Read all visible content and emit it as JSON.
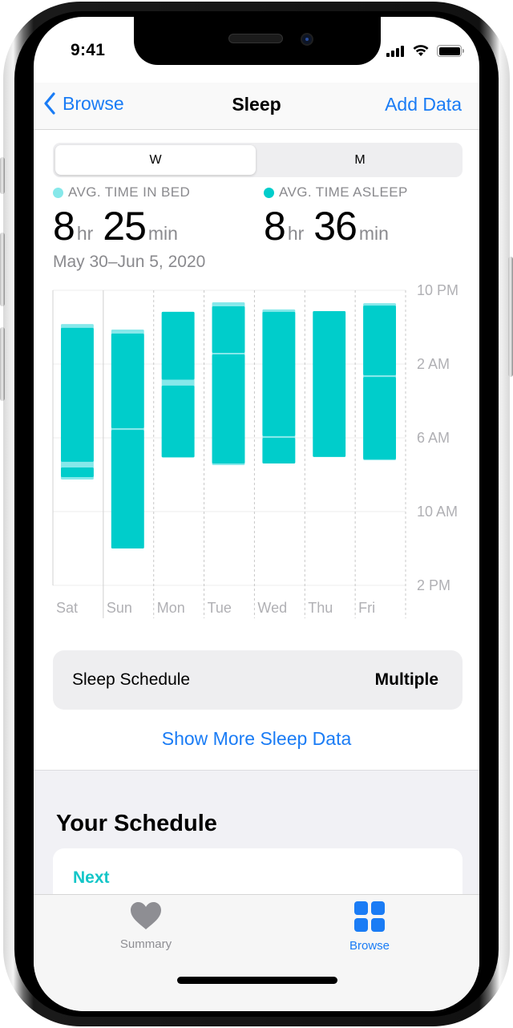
{
  "status_bar": {
    "time": "9:41",
    "signal_icon": "cellular-signal-icon",
    "wifi_icon": "wifi-icon",
    "battery_icon": "battery-icon"
  },
  "nav": {
    "back_label": "Browse",
    "title": "Sleep",
    "action_label": "Add Data"
  },
  "segmented": {
    "options": [
      "W",
      "M"
    ],
    "selected": "W"
  },
  "stats": {
    "in_bed": {
      "label": "AVG. TIME IN BED",
      "hours": "8",
      "hr_unit": "hr",
      "minutes": "25",
      "min_unit": "min",
      "color": "#86e8ea"
    },
    "asleep": {
      "label": "AVG. TIME ASLEEP",
      "hours": "8",
      "hr_unit": "hr",
      "minutes": "36",
      "min_unit": "min",
      "color": "#00cdcb"
    }
  },
  "date_range": "May 30–Jun 5, 2020",
  "chart_data": {
    "type": "bar",
    "subtype": "floating-range",
    "title": "",
    "xlabel": "",
    "ylabel": "",
    "units": "hours after 10 PM",
    "categories": [
      "Sat",
      "Sun",
      "Mon",
      "Tue",
      "Wed",
      "Thu",
      "Fri"
    ],
    "y_ticks": [
      "10 PM",
      "2 AM",
      "6 AM",
      "10 AM",
      "2 PM"
    ],
    "y_tick_values": [
      0,
      4,
      8,
      12,
      16
    ],
    "ylim": [
      0,
      16
    ],
    "grid": true,
    "series": [
      {
        "name": "In Bed",
        "color": "#86e8ea",
        "values": [
          [
            [
              1.83,
              10.26
            ]
          ],
          [
            [
              2.13,
              14.0
            ]
          ],
          [
            [
              1.17,
              9.06
            ]
          ],
          [
            [
              0.65,
              9.48
            ]
          ],
          [
            [
              1.04,
              9.39
            ]
          ],
          [],
          [
            [
              0.7,
              9.22
            ]
          ]
        ]
      },
      {
        "name": "Asleep",
        "color": "#00cdcb",
        "values": [
          [
            [
              2.04,
              9.3
            ],
            [
              9.61,
              10.13
            ]
          ],
          [
            [
              2.35,
              7.48
            ],
            [
              7.57,
              14.0
            ]
          ],
          [
            [
              1.17,
              4.85
            ],
            [
              5.17,
              9.06
            ]
          ],
          [
            [
              0.87,
              3.39
            ],
            [
              3.48,
              9.39
            ]
          ],
          [
            [
              1.17,
              7.91
            ],
            [
              8.0,
              9.39
            ]
          ],
          [
            [
              1.13,
              9.04
            ]
          ],
          [
            [
              0.83,
              4.61
            ],
            [
              4.7,
              9.17
            ]
          ]
        ]
      }
    ]
  },
  "sleep_schedule": {
    "label": "Sleep Schedule",
    "value": "Multiple"
  },
  "show_more_label": "Show More Sleep Data",
  "your_schedule": {
    "title": "Your Schedule",
    "next_label": "Next"
  },
  "tabbar": {
    "items": [
      {
        "label": "Summary",
        "icon": "heart-icon",
        "active": false
      },
      {
        "label": "Browse",
        "icon": "browse-grid-icon",
        "active": true
      }
    ]
  },
  "colors": {
    "accent": "#1a7cf5",
    "sleep_teal": "#00cdcb",
    "in_bed_teal": "#86e8ea",
    "inactive_gray": "#8e8e93"
  }
}
